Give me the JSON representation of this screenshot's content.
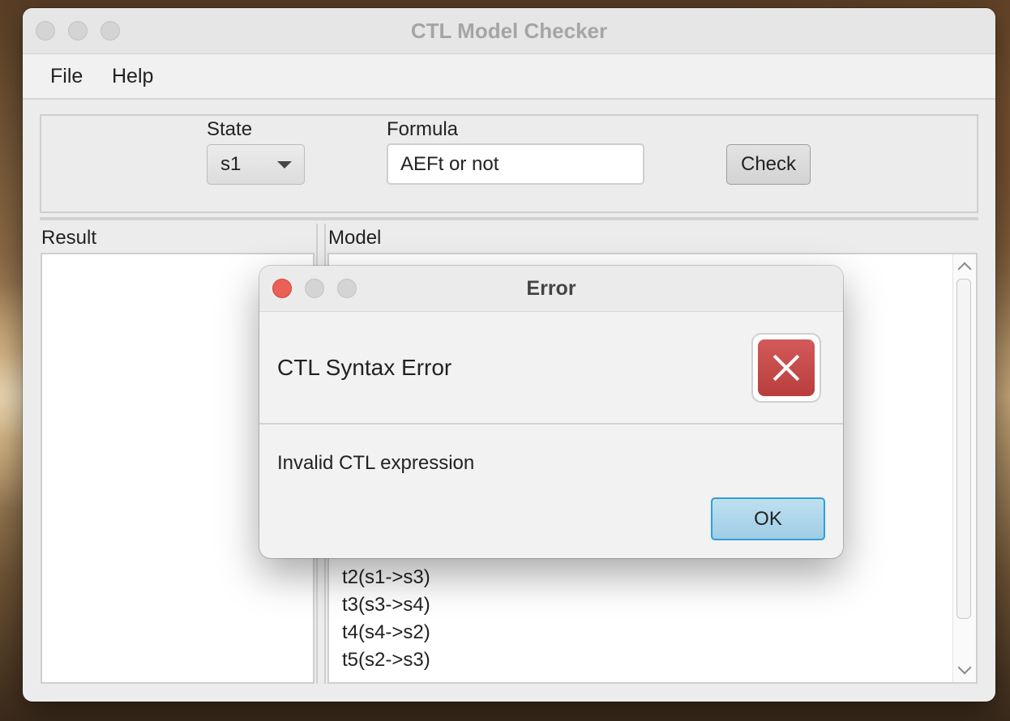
{
  "window": {
    "title": "CTL Model Checker"
  },
  "menu": {
    "items": [
      "File",
      "Help"
    ]
  },
  "controls": {
    "state_label": "State",
    "state_value": "s1",
    "formula_label": "Formula",
    "formula_value": "AEFt or not",
    "check_label": "Check"
  },
  "panes": {
    "result_label": "Result",
    "model_label": "Model",
    "model_lines": [
      "t2(s1->s3)",
      "t3(s3->s4)",
      "t4(s4->s2)",
      "t5(s2->s3)"
    ]
  },
  "dialog": {
    "title": "Error",
    "heading": "CTL Syntax Error",
    "message": "Invalid CTL expression",
    "ok_label": "OK",
    "icon": "error-x-icon"
  },
  "colors": {
    "close_red": "#ec5f56",
    "error_red": "#c44a4a",
    "ok_blue": "#2f9fd8"
  }
}
